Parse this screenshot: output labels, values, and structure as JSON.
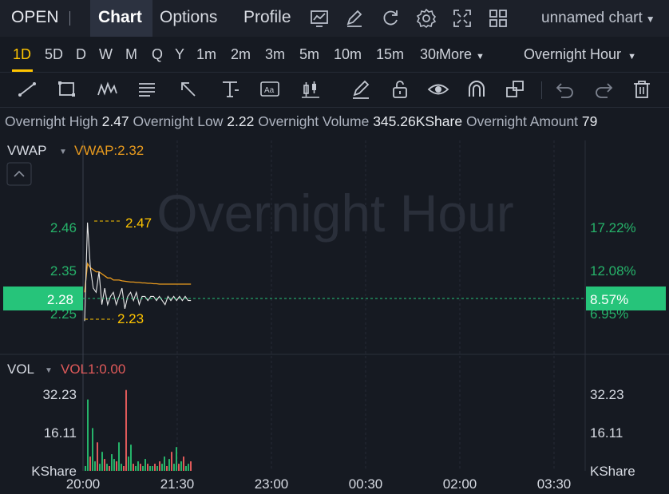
{
  "header": {
    "ticker": "OPEN",
    "tabs": [
      {
        "label": "Chart",
        "active": true
      },
      {
        "label": "Options",
        "active": false
      },
      {
        "label": "Profile",
        "active": false
      }
    ],
    "icons": [
      "chart-settings-icon",
      "edit-icon",
      "refresh-icon",
      "gear-icon",
      "fullscreen-icon",
      "layout-grid-icon"
    ],
    "chart_name": "unnamed chart"
  },
  "periods": {
    "items": [
      "1D",
      "5D",
      "D",
      "W",
      "M",
      "Q",
      "Y",
      "1m",
      "2m",
      "3m",
      "5m",
      "10m",
      "15m",
      "30m"
    ],
    "active": "1D",
    "more_label": "More",
    "session_label": "Overnight Hour"
  },
  "tools": [
    "line-tool-icon",
    "rectangle-tool-icon",
    "pattern-tool-icon",
    "text-tool-icon",
    "arrow-tool-icon",
    "measure-tool-icon",
    "note-tool-icon",
    "candle-tool-icon",
    "brush-icon",
    "unlock-icon",
    "eye-icon",
    "magnet-icon",
    "copy-icon",
    "undo-icon",
    "redo-icon",
    "trash-icon"
  ],
  "info": {
    "high_label": "Overnight High",
    "high_value": "2.47",
    "low_label": "Overnight Low",
    "low_value": "2.22",
    "volume_label": "Overnight Volume",
    "volume_value": "345.26KShare",
    "amount_label": "Overnight Amount",
    "amount_value": "79"
  },
  "colors": {
    "up": "#26b36a",
    "down": "#e05a5a",
    "accent": "#ffc400",
    "vwap": "#e89a1e",
    "price_badge": "#26c47a",
    "bg": "#161a22"
  },
  "chart_data": {
    "type": "line",
    "watermark": "Overnight Hour",
    "vwap_label": "VWAP",
    "vwap_value_text": "VWAP:2.32",
    "vol_label": "VOL",
    "vol_value_text": "VOL1:0.00",
    "y_ticks": [
      "2.46",
      "2.35",
      "2.25"
    ],
    "pct_ticks": [
      "17.22%",
      "12.08%",
      "6.95%"
    ],
    "current_price": "2.28",
    "current_pct": "8.57%",
    "high_marker": "2.47",
    "low_marker": "2.23",
    "x_ticks": [
      "20:00",
      "21:30",
      "23:00",
      "00:30",
      "02:00",
      "03:30"
    ],
    "vol_ticks": [
      "32.23",
      "16.11"
    ],
    "vol_unit": "KShare",
    "price_series": [
      2.23,
      2.47,
      2.36,
      2.31,
      2.3,
      2.35,
      2.27,
      2.31,
      2.27,
      2.29,
      2.3,
      2.27,
      2.29,
      2.31,
      2.26,
      2.29,
      2.3,
      2.28,
      2.3,
      2.27,
      2.29,
      2.29,
      2.28,
      2.29,
      2.29,
      2.28,
      2.29,
      2.28,
      2.27,
      2.29,
      2.28,
      2.29,
      2.28,
      2.29,
      2.28,
      2.29,
      2.28,
      2.28
    ],
    "vwap_series": [
      2.3,
      2.37,
      2.36,
      2.355,
      2.35,
      2.35,
      2.345,
      2.34,
      2.335,
      2.335,
      2.33,
      2.33,
      2.33,
      2.328,
      2.327,
      2.326,
      2.325,
      2.325,
      2.324,
      2.324,
      2.323,
      2.323,
      2.322,
      2.322,
      2.321,
      2.321,
      2.32,
      2.32,
      2.32,
      2.32,
      2.32,
      2.32,
      2.32,
      2.32,
      2.32,
      2.32,
      2.32,
      2.32
    ],
    "volume_series": [
      2,
      30,
      6,
      18,
      4,
      12,
      3,
      8,
      5,
      3,
      2,
      7,
      5,
      4,
      12,
      3,
      2,
      34,
      6,
      11,
      3,
      2,
      4,
      3,
      2,
      5,
      3,
      2,
      2,
      3,
      2,
      4,
      3,
      6,
      2,
      5,
      8,
      3,
      10,
      3,
      4,
      6,
      2,
      3,
      4
    ],
    "volume_up": [
      true,
      true,
      false,
      true,
      true,
      false,
      true,
      true,
      false,
      true,
      false,
      true,
      true,
      false,
      true,
      true,
      false,
      false,
      true,
      true,
      false,
      true,
      true,
      false,
      true,
      true,
      false,
      true,
      true,
      false,
      true,
      false,
      true,
      true,
      false,
      true,
      false,
      true,
      true,
      false,
      true,
      false,
      true,
      true,
      false
    ]
  }
}
